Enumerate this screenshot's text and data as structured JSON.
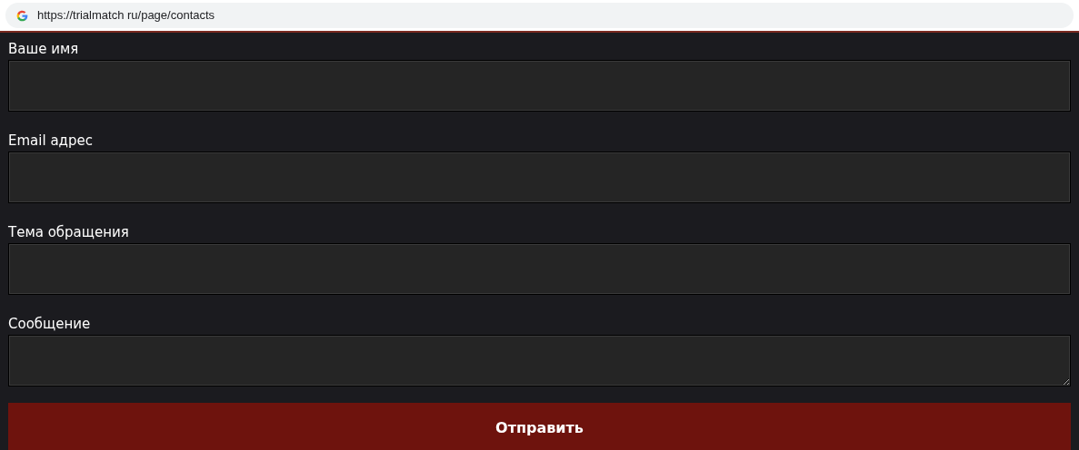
{
  "browser": {
    "url": "https://trialmatch ru/page/contacts"
  },
  "form": {
    "fields": [
      {
        "label": "Ваше имя",
        "kind": "input"
      },
      {
        "label": "Email адрес",
        "kind": "input"
      },
      {
        "label": "Тема обращения",
        "kind": "input"
      },
      {
        "label": "Сообщение",
        "kind": "textarea"
      }
    ],
    "submit": "Отправить"
  }
}
